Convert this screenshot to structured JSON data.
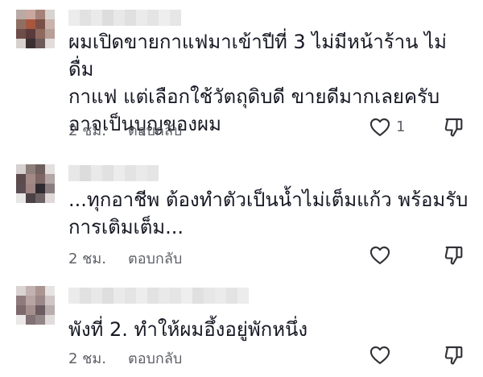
{
  "comments": [
    {
      "text": "ผมเปิดขายกาแฟมาเข้าปีที่ 3 ไม่มีหน้าร้าน ไม่ดื่ม\nกาแฟ แต่เลือกใช้วัตถุดิบดี ขายดีมากเลยครับ\nอาจเป็นบุญของผม",
      "time": "2 ชม.",
      "reply_label": "ตอบกลับ",
      "like_count": "1"
    },
    {
      "text": "...ทุกอาชีพ ต้องทำตัวเป็นน้ำไม่เต็มแก้ว พร้อมรับ\nการเติมเต็ม...",
      "time": "2 ชม.",
      "reply_label": "ตอบกลับ",
      "like_count": ""
    },
    {
      "text": "พังที่ 2. ทำให้ผมอึ้งอยู่พักหนึ่ง",
      "time": "2 ชม.",
      "reply_label": "ตอบกลับ",
      "like_count": ""
    }
  ],
  "icons": {
    "like": "heart-outline-icon",
    "dislike": "thumbs-down-outline-icon"
  },
  "colors": {
    "text": "#161823",
    "meta": "#5f6168",
    "icon": "#2f3035"
  }
}
